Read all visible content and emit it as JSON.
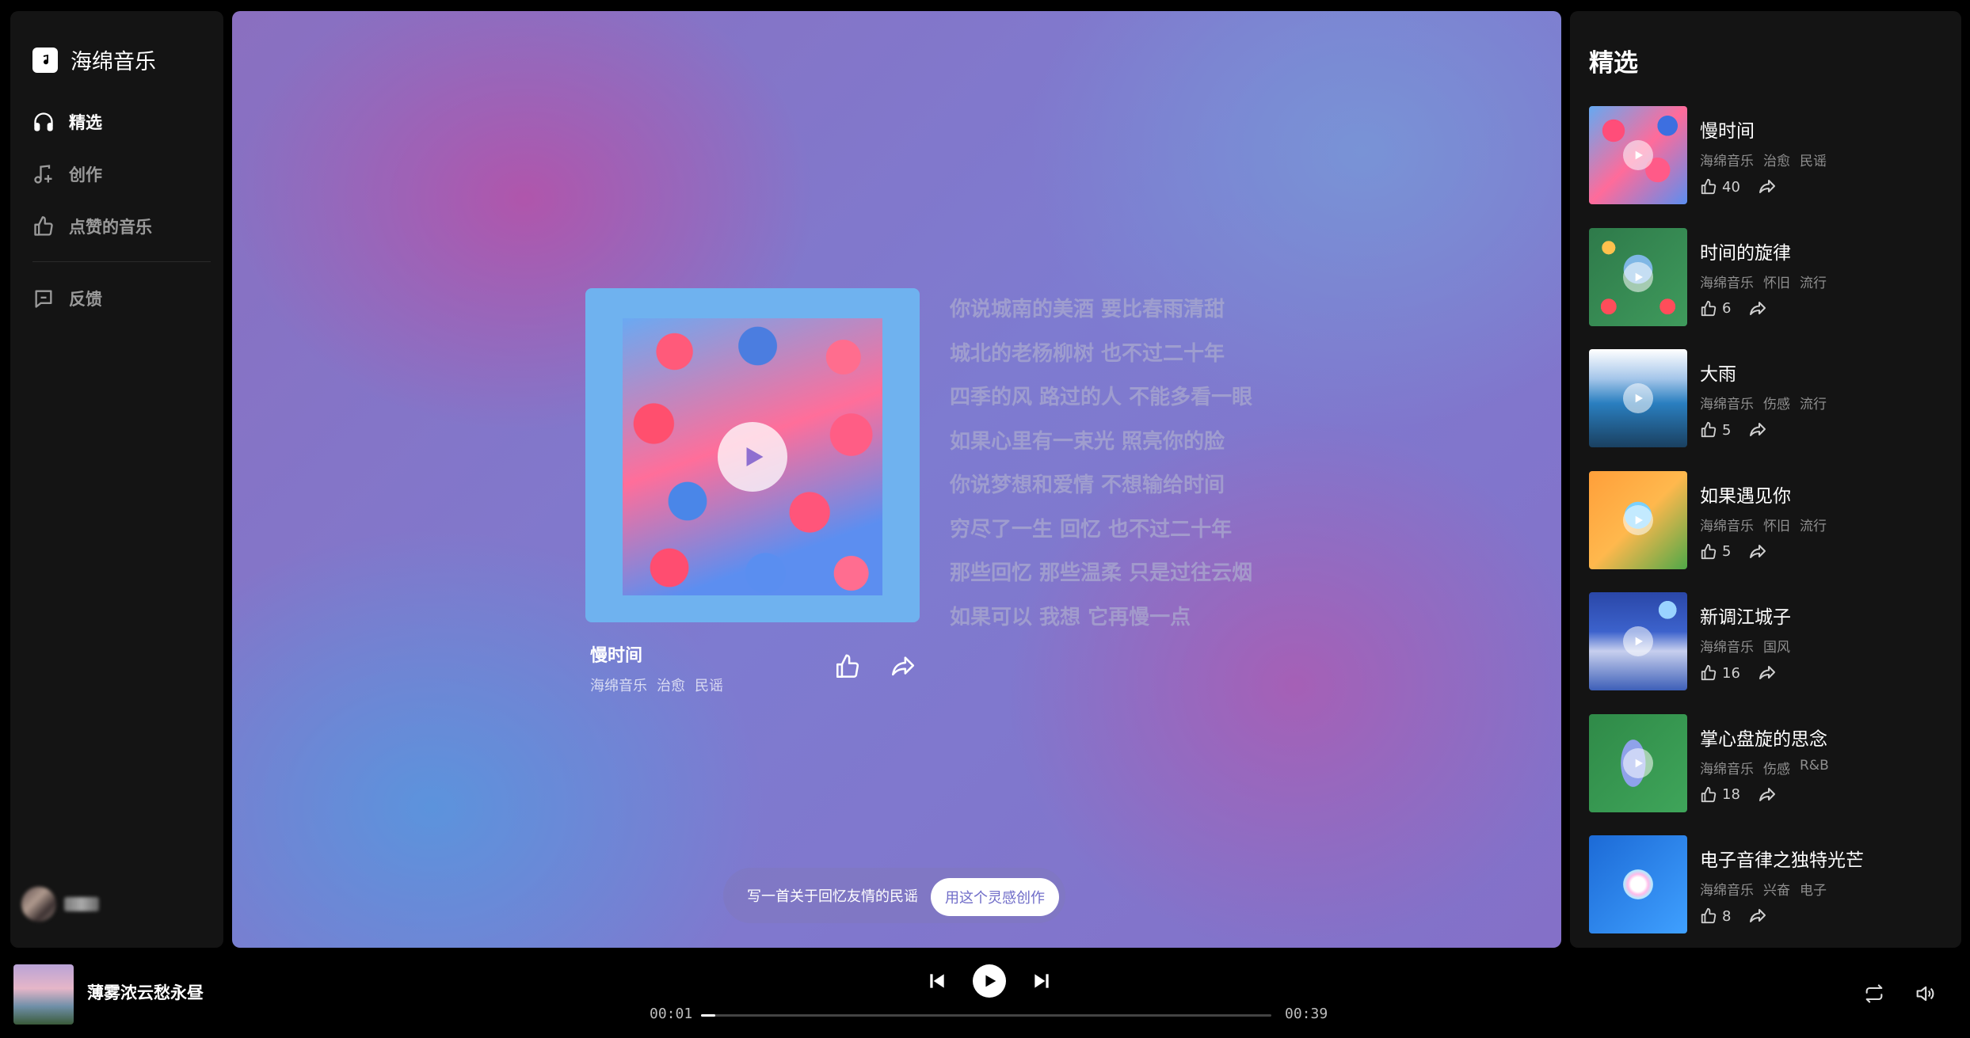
{
  "brand": {
    "name": "海绵音乐"
  },
  "nav": {
    "items": [
      {
        "label": "精选",
        "icon": "headphones-icon",
        "active": true
      },
      {
        "label": "创作",
        "icon": "music-note-add-icon",
        "active": false
      },
      {
        "label": "点赞的音乐",
        "icon": "thumbs-up-icon",
        "active": false
      }
    ],
    "feedback": {
      "label": "反馈",
      "icon": "feedback-icon"
    }
  },
  "current_song": {
    "title": "慢时间",
    "tags": [
      "海绵音乐",
      "治愈",
      "民谣"
    ],
    "lyrics": [
      "你说城南的美酒 要比春雨清甜",
      "城北的老杨柳树 也不过二十年",
      "四季的风 路过的人 不能多看一眼",
      "如果心里有一束光 照亮你的脸",
      "你说梦想和爱情 不想输给时间",
      "穷尽了一生 回忆 也不过二十年",
      "那些回忆 那些温柔 只是过往云烟",
      "如果可以 我想 它再慢一点"
    ]
  },
  "prompt": {
    "text": "写一首关于回忆友情的民谣",
    "button": "用这个灵感创作"
  },
  "featured": {
    "title": "精选",
    "items": [
      {
        "name": "慢时间",
        "tags": [
          "海绵音乐",
          "治愈",
          "民谣"
        ],
        "likes": "40"
      },
      {
        "name": "时间的旋律",
        "tags": [
          "海绵音乐",
          "怀旧",
          "流行"
        ],
        "likes": "6"
      },
      {
        "name": "大雨",
        "tags": [
          "海绵音乐",
          "伤感",
          "流行"
        ],
        "likes": "5"
      },
      {
        "name": "如果遇见你",
        "tags": [
          "海绵音乐",
          "怀旧",
          "流行"
        ],
        "likes": "5"
      },
      {
        "name": "新调江城子",
        "tags": [
          "海绵音乐",
          "国风"
        ],
        "likes": "16"
      },
      {
        "name": "掌心盘旋的思念",
        "tags": [
          "海绵音乐",
          "伤感",
          "R&B"
        ],
        "likes": "18"
      },
      {
        "name": "电子音律之独特光芒",
        "tags": [
          "海绵音乐",
          "兴奋",
          "电子"
        ],
        "likes": "8"
      }
    ]
  },
  "player": {
    "title": "薄雾浓云愁永昼",
    "current_time": "00:01",
    "total_time": "00:39",
    "progress": 0.025
  },
  "colors": {
    "accent": "#6f6cc8",
    "panel": "#141414",
    "background": "#000000"
  }
}
